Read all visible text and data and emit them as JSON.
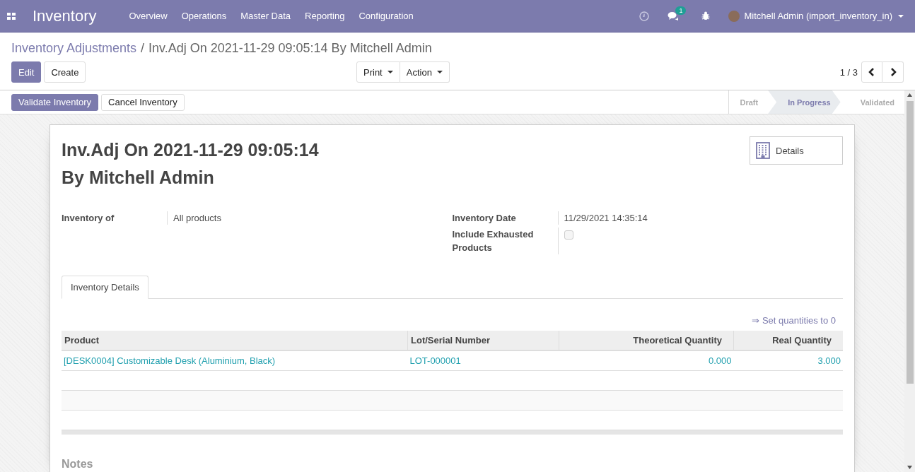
{
  "navbar": {
    "app_name": "Inventory",
    "menu": [
      "Overview",
      "Operations",
      "Master Data",
      "Reporting",
      "Configuration"
    ],
    "messages_badge": "1",
    "user": "Mitchell Admin (import_inventory_in)"
  },
  "breadcrumb": {
    "parent": "Inventory Adjustments",
    "separator": "/",
    "current": "Inv.Adj On 2021-11-29 09:05:14 By Mitchell Admin"
  },
  "buttons": {
    "edit": "Edit",
    "create": "Create",
    "print": "Print",
    "action": "Action"
  },
  "pager": "1 / 3",
  "header_buttons": [
    {
      "label": "Validate Inventory",
      "kind": "primary"
    },
    {
      "label": "Cancel Inventory",
      "kind": "secondary"
    }
  ],
  "stages": [
    {
      "label": "Draft",
      "selected": false
    },
    {
      "label": "In Progress",
      "selected": true
    },
    {
      "label": "Validated",
      "selected": false
    }
  ],
  "smart_button": "Details",
  "title_lines": [
    "Inv.Adj On 2021-11-29 09:05:14",
    "By Mitchell Admin"
  ],
  "left_fields": [
    {
      "label": "Inventory of",
      "value": "All products"
    }
  ],
  "right_fields": [
    {
      "label": "Inventory Date",
      "kind": "text",
      "value": "11/29/2021 14:35:14"
    },
    {
      "label": "Include Exhausted Products",
      "kind": "checkbox",
      "checked": false
    }
  ],
  "tabs": [
    {
      "label": "Inventory Details",
      "selected": true
    }
  ],
  "set_quantities_link": "⇒ Set quantities to 0",
  "table": {
    "columns": [
      "Product",
      "Lot/Serial Number",
      "Theoretical Quantity",
      "Real Quantity"
    ],
    "rows": [
      [
        "[DESK0004] Customizable Desk (Aluminium, Black)",
        "LOT-000001",
        "0.000",
        "3.000"
      ]
    ]
  },
  "notes_label": "Notes"
}
